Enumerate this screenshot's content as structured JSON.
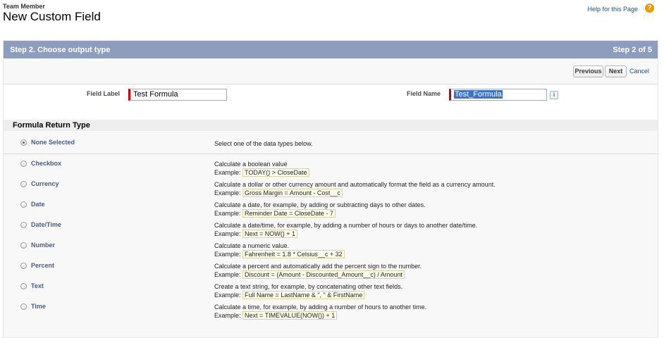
{
  "header": {
    "breadcrumb": "Team Member",
    "title": "New Custom Field",
    "help_link": "Help for this Page",
    "help_icon": "question-icon"
  },
  "step": {
    "title": "Step 2. Choose output type",
    "progress": "Step 2 of 5"
  },
  "buttons": {
    "previous": "Previous",
    "next": "Next",
    "cancel": "Cancel"
  },
  "fields": {
    "label_label": "Field Label",
    "label_value": "Test Formula",
    "name_label": "Field Name",
    "name_value": "Test_Formula",
    "info_icon": "i"
  },
  "section": {
    "title": "Formula Return Type"
  },
  "types": {
    "none": {
      "name": "None Selected",
      "desc": "Select one of the data types below."
    },
    "checkbox": {
      "name": "Checkbox",
      "desc": "Calculate a boolean value",
      "example_label": "Example:",
      "example": "TODAY() > CloseDate"
    },
    "currency": {
      "name": "Currency",
      "desc": "Calculate a dollar or other currency amount and automatically format the field as a currency amount.",
      "example_label": "Example:",
      "example": "Gross Margin = Amount - Cost__c"
    },
    "date": {
      "name": "Date",
      "desc": "Calculate a date, for example, by adding or subtracting days to other dates.",
      "example_label": "Example:",
      "example": "Reminder Date = CloseDate - 7"
    },
    "datetime": {
      "name": "Date/Time",
      "desc": "Calculate a date/time, for example, by adding a number of hours or days to another date/time.",
      "example_label": "Example:",
      "example": "Next = NOW() + 1"
    },
    "number": {
      "name": "Number",
      "desc": "Calculate a numeric value.",
      "example_label": "Example:",
      "example": "Fahrenheit = 1.8 * Celsius__c + 32"
    },
    "percent": {
      "name": "Percent",
      "desc": "Calculate a percent and automatically add the percent sign to the number.",
      "example_label": "Example:",
      "example": "Discount = (Amount - Discounted_Amount__c) / Amount"
    },
    "text": {
      "name": "Text",
      "desc": "Create a text string, for example, by concatenating other text fields.",
      "example_label": "Example:",
      "example": "Full Name = LastName & \", \" & FirstName"
    },
    "time": {
      "name": "Time",
      "desc": "Calculate a time, for example, by adding a number of hours to another time.",
      "example_label": "Example:",
      "example": "Next = TIMEVALUE(NOW()) + 1"
    }
  },
  "colors": {
    "step_header": "#8e9dbe",
    "link": "#015ba7",
    "required_marker": "#cc0000"
  }
}
